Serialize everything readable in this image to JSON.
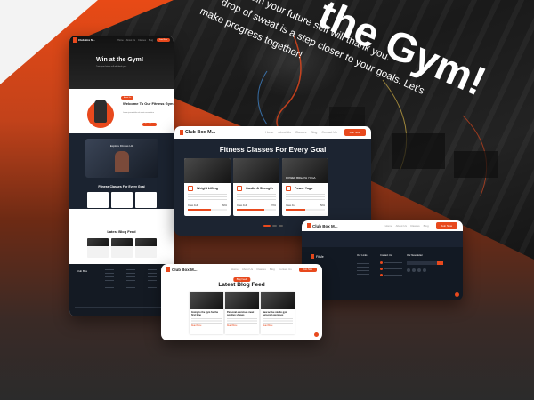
{
  "hero": {
    "title": "the Gym!",
    "tagline_1": "Train your future self will thank you.",
    "tagline_2": "drop of sweat is a step closer to your goals. Let's",
    "tagline_3": "make progress together!"
  },
  "brand": {
    "name": "Club Box M...",
    "accent": "#e8491d"
  },
  "nav": {
    "links": [
      "Home",
      "About Us",
      "Classes",
      "Blog",
      "Contact Us"
    ],
    "cta": "Join Now"
  },
  "home_page": {
    "hero_title": "Win at the Gym!",
    "hero_sub": "Train your future self will thank you.",
    "welcome_badge": "About Us",
    "welcome_title": "Welcome To Our Fitness Gym",
    "welcome_text": "Lorem ipsum dolor sit amet consectetur",
    "welcome_button": "Read More",
    "explore_title": "Explore Fitness Life",
    "classes_title": "Fitness Classes For Every Goal",
    "blog_title": "Latest Blog Feed",
    "footer_logo": "Club Box"
  },
  "classes_page": {
    "title": "Fitness Classes For Every Goal",
    "classes": [
      {
        "name": "Weight Lifting",
        "caption": "",
        "level": "Class Full",
        "percent": "60%",
        "fill": 0.6
      },
      {
        "name": "Cardio & Strength",
        "caption": "",
        "level": "Class Full",
        "percent": "70%",
        "fill": 0.7
      },
      {
        "name": "Power Yoga",
        "caption": "POWER BREATH YOGA",
        "level": "Class Full",
        "percent": "50%",
        "fill": 0.5
      }
    ]
  },
  "footer_page": {
    "logo": "FitMe",
    "col1": "Our Links",
    "col2": "Contact Us",
    "col3": "Our Newsletter"
  },
  "blog_page": {
    "chip": "Blog Feed",
    "title": "Latest Blog Feed",
    "posts": [
      {
        "title": "Going to the gym for the first time",
        "read": "Read More"
      },
      {
        "title": "Personal exercises meet positive shapes",
        "read": "Read More"
      },
      {
        "title": "New active studio gym personal exercises",
        "read": "Read More"
      }
    ]
  }
}
